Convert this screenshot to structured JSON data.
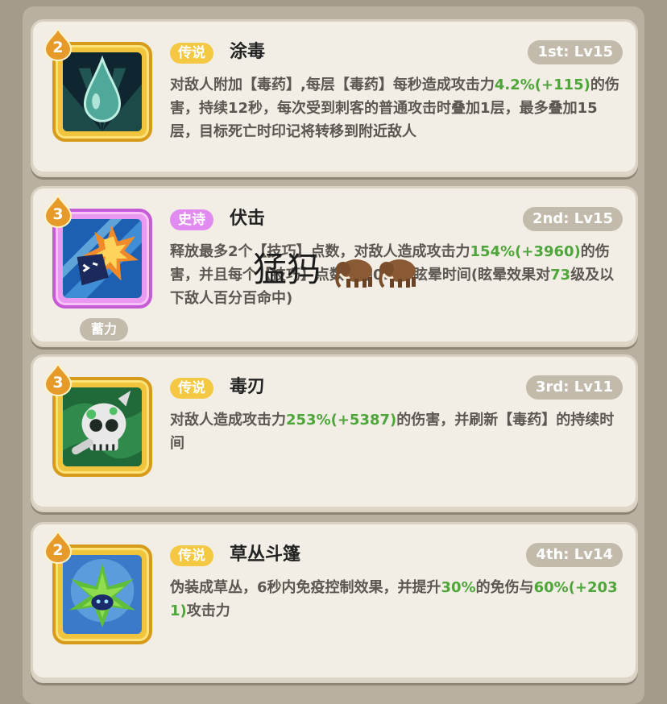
{
  "skills": [
    {
      "level": "2",
      "rarity": "传说",
      "name": "涂毒",
      "rank": "1st: Lv15",
      "desc": [
        {
          "t": "对敌人附加【毒药】,每层【毒药】每秒造成攻击力"
        },
        {
          "t": "4.2%(+115)",
          "g": true
        },
        {
          "t": "的伤害，持续12秒，每次受到刺客的普通攻击时叠加1层，最多叠加15层，目标死亡时印记将转移到附近敌人"
        }
      ]
    },
    {
      "level": "3",
      "rarity": "史诗",
      "name": "伏击",
      "rank": "2nd: Lv15",
      "tag": "蓄力",
      "desc": [
        {
          "t": "释放最多2个【技巧】点数，对敌人造成攻击力"
        },
        {
          "t": "154%(+3960)",
          "g": true
        },
        {
          "t": "的伤害，并且每个【技巧】点数增加0.5秒眩晕时间(眩晕效果对"
        },
        {
          "t": "73",
          "g": true
        },
        {
          "t": "级及以下敌人百分百命中)"
        }
      ]
    },
    {
      "level": "3",
      "rarity": "传说",
      "name": "毒刃",
      "rank": "3rd: Lv11",
      "desc": [
        {
          "t": "对敌人造成攻击力"
        },
        {
          "t": "253%(+5387)",
          "g": true
        },
        {
          "t": "的伤害，并刷新【毒药】的持续时间"
        }
      ]
    },
    {
      "level": "2",
      "rarity": "传说",
      "name": "草丛斗篷",
      "rank": "4th: Lv14",
      "desc": [
        {
          "t": "伪装成草丛，6秒内免疫控制效果，并提升"
        },
        {
          "t": "30%",
          "g": true
        },
        {
          "t": "的免伤与"
        },
        {
          "t": "60%(+2031)",
          "g": true
        },
        {
          "t": "攻击力"
        }
      ]
    }
  ],
  "watermark": "猛犸",
  "colors": {
    "legend": "#f4c842",
    "epic": "#e18bf0",
    "highlight": "#4ea63a"
  }
}
